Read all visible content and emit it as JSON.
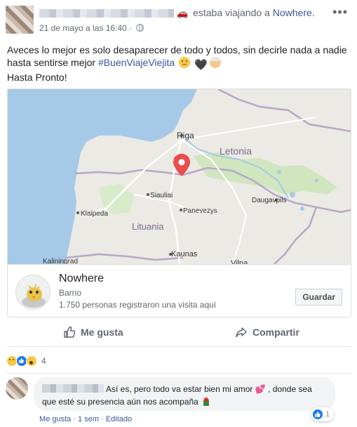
{
  "post": {
    "activity_text": "estaba viajando a",
    "activity_place": "Nowhere.",
    "timestamp": "21 de mayo a las 16:40",
    "more_menu": "•••",
    "body_line1": "Aveces lo mejor es solo desaparecer de todo y todos, sin decirle nada a nadie hasta sentirse mejor",
    "hashtag": "#BuenViajeViejita",
    "heart_emoji": "🖤",
    "body_line2": "Hasta Pronto!"
  },
  "map": {
    "labels": {
      "riga": "Riga",
      "letonia": "Letonia",
      "siauliai": "Siauliai",
      "daugavpils": "Daugavpils",
      "klaipeda": "Klaipeda",
      "panevezys": "Panevezys",
      "lituania": "Lituania",
      "kaunas": "Kaunas",
      "vilna": "Vilna",
      "kaliningrad": "Kaliningrad"
    },
    "colors": {
      "sea": "#a6c9e8",
      "land": "#eceae4",
      "border": "#b7a7c7",
      "road": "#ffffff",
      "forest": "#c9e4b8",
      "pin": "#e94d4d"
    }
  },
  "place": {
    "name": "Nowhere",
    "category": "Barrio",
    "visits": "1.750 personas registraron una visita aquí",
    "save_label": "Guardar"
  },
  "actions": {
    "like_label": "Me gusta",
    "share_label": "Compartir"
  },
  "reactions": {
    "count": "4",
    "types": [
      "sad",
      "like",
      "wow"
    ]
  },
  "comment": {
    "text_part1": "Así es, pero todo va estar bien mi amor",
    "heart": "💕",
    "text_part2": ", donde sea que esté su presencia aún nos acompaña",
    "reaction_count": "1",
    "like_link": "Me gusta",
    "separator": "·",
    "time": "1 sem",
    "edited": "Editado"
  }
}
